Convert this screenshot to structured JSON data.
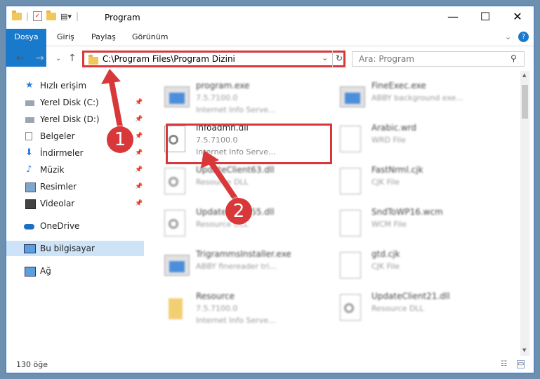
{
  "window": {
    "title": "Program",
    "minimize": "—",
    "maximize": "☐",
    "close": "✕"
  },
  "ribbon": {
    "tabs": [
      "Dosya",
      "Giriş",
      "Paylaş",
      "Görünüm"
    ]
  },
  "address": {
    "path": "C:\\Program Files\\Program Dizini",
    "search_placeholder": "Ara: Program"
  },
  "sidebar": {
    "items": [
      {
        "label": "Hızlı erişim"
      },
      {
        "label": "Yerel Disk (C:)"
      },
      {
        "label": "Yerel Disk (D:)"
      },
      {
        "label": "Belgeler"
      },
      {
        "label": "İndirmeler"
      },
      {
        "label": "Müzik"
      },
      {
        "label": "Resimler"
      },
      {
        "label": "Videolar"
      },
      {
        "label": "OneDrive"
      },
      {
        "label": "Bu bilgisayar"
      },
      {
        "label": "Ağ"
      }
    ]
  },
  "files": {
    "left": [
      {
        "name": "program.exe",
        "l2": "7.5.7100.0",
        "l3": "Internet Info Serve..."
      },
      {
        "name": "infoadmn.dll",
        "l2": "7.5.7100.0",
        "l3": "Internet Info Serve..."
      },
      {
        "name": "UpdateClient63.dll",
        "l2": "Resource DLL",
        "l3": ""
      },
      {
        "name": "UpdateClient55.dll",
        "l2": "Resource DLL",
        "l3": ""
      },
      {
        "name": "TrigrammsInstaller.exe",
        "l2": "ABBY finereader tri...",
        "l3": ""
      },
      {
        "name": "Resource",
        "l2": "7.5.7100.0",
        "l3": "Internet Info Serve..."
      }
    ],
    "right": [
      {
        "name": "FineExec.exe",
        "l2": "ABBY background exe..."
      },
      {
        "name": "Arabic.wrd",
        "l2": "WRD File"
      },
      {
        "name": "FastNrml.cjk",
        "l2": "CJK File"
      },
      {
        "name": "SndToWP16.wcm",
        "l2": "WCM File"
      },
      {
        "name": "gtd.cjk",
        "l2": "CJK File"
      },
      {
        "name": "UpdateClient21.dll",
        "l2": "Resource DLL"
      }
    ]
  },
  "status": {
    "count": "130 öğe"
  },
  "annotations": {
    "one": "1",
    "two": "2"
  },
  "colors": {
    "accent": "#1979ca",
    "highlight": "#d9383a"
  }
}
